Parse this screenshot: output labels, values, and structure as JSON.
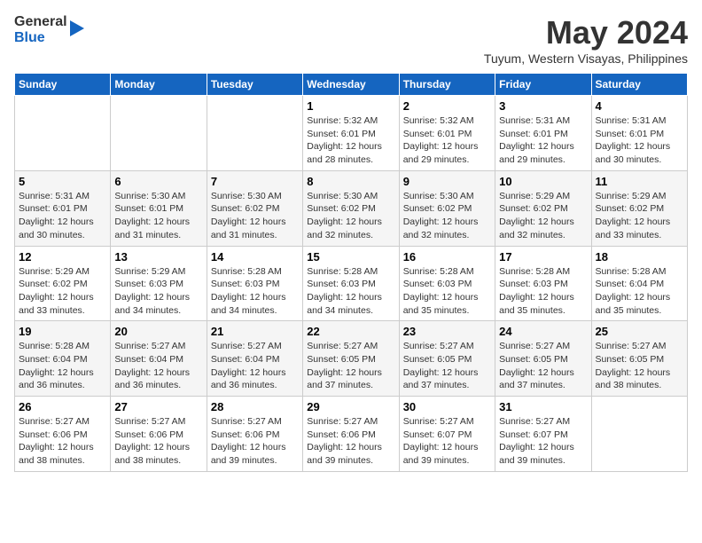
{
  "logo": {
    "general": "General",
    "blue": "Blue"
  },
  "title": "May 2024",
  "location": "Tuyum, Western Visayas, Philippines",
  "days_header": [
    "Sunday",
    "Monday",
    "Tuesday",
    "Wednesday",
    "Thursday",
    "Friday",
    "Saturday"
  ],
  "weeks": [
    [
      {
        "day": "",
        "info": ""
      },
      {
        "day": "",
        "info": ""
      },
      {
        "day": "",
        "info": ""
      },
      {
        "day": "1",
        "info": "Sunrise: 5:32 AM\nSunset: 6:01 PM\nDaylight: 12 hours\nand 28 minutes."
      },
      {
        "day": "2",
        "info": "Sunrise: 5:32 AM\nSunset: 6:01 PM\nDaylight: 12 hours\nand 29 minutes."
      },
      {
        "day": "3",
        "info": "Sunrise: 5:31 AM\nSunset: 6:01 PM\nDaylight: 12 hours\nand 29 minutes."
      },
      {
        "day": "4",
        "info": "Sunrise: 5:31 AM\nSunset: 6:01 PM\nDaylight: 12 hours\nand 30 minutes."
      }
    ],
    [
      {
        "day": "5",
        "info": "Sunrise: 5:31 AM\nSunset: 6:01 PM\nDaylight: 12 hours\nand 30 minutes."
      },
      {
        "day": "6",
        "info": "Sunrise: 5:30 AM\nSunset: 6:01 PM\nDaylight: 12 hours\nand 31 minutes."
      },
      {
        "day": "7",
        "info": "Sunrise: 5:30 AM\nSunset: 6:02 PM\nDaylight: 12 hours\nand 31 minutes."
      },
      {
        "day": "8",
        "info": "Sunrise: 5:30 AM\nSunset: 6:02 PM\nDaylight: 12 hours\nand 32 minutes."
      },
      {
        "day": "9",
        "info": "Sunrise: 5:30 AM\nSunset: 6:02 PM\nDaylight: 12 hours\nand 32 minutes."
      },
      {
        "day": "10",
        "info": "Sunrise: 5:29 AM\nSunset: 6:02 PM\nDaylight: 12 hours\nand 32 minutes."
      },
      {
        "day": "11",
        "info": "Sunrise: 5:29 AM\nSunset: 6:02 PM\nDaylight: 12 hours\nand 33 minutes."
      }
    ],
    [
      {
        "day": "12",
        "info": "Sunrise: 5:29 AM\nSunset: 6:02 PM\nDaylight: 12 hours\nand 33 minutes."
      },
      {
        "day": "13",
        "info": "Sunrise: 5:29 AM\nSunset: 6:03 PM\nDaylight: 12 hours\nand 34 minutes."
      },
      {
        "day": "14",
        "info": "Sunrise: 5:28 AM\nSunset: 6:03 PM\nDaylight: 12 hours\nand 34 minutes."
      },
      {
        "day": "15",
        "info": "Sunrise: 5:28 AM\nSunset: 6:03 PM\nDaylight: 12 hours\nand 34 minutes."
      },
      {
        "day": "16",
        "info": "Sunrise: 5:28 AM\nSunset: 6:03 PM\nDaylight: 12 hours\nand 35 minutes."
      },
      {
        "day": "17",
        "info": "Sunrise: 5:28 AM\nSunset: 6:03 PM\nDaylight: 12 hours\nand 35 minutes."
      },
      {
        "day": "18",
        "info": "Sunrise: 5:28 AM\nSunset: 6:04 PM\nDaylight: 12 hours\nand 35 minutes."
      }
    ],
    [
      {
        "day": "19",
        "info": "Sunrise: 5:28 AM\nSunset: 6:04 PM\nDaylight: 12 hours\nand 36 minutes."
      },
      {
        "day": "20",
        "info": "Sunrise: 5:27 AM\nSunset: 6:04 PM\nDaylight: 12 hours\nand 36 minutes."
      },
      {
        "day": "21",
        "info": "Sunrise: 5:27 AM\nSunset: 6:04 PM\nDaylight: 12 hours\nand 36 minutes."
      },
      {
        "day": "22",
        "info": "Sunrise: 5:27 AM\nSunset: 6:05 PM\nDaylight: 12 hours\nand 37 minutes."
      },
      {
        "day": "23",
        "info": "Sunrise: 5:27 AM\nSunset: 6:05 PM\nDaylight: 12 hours\nand 37 minutes."
      },
      {
        "day": "24",
        "info": "Sunrise: 5:27 AM\nSunset: 6:05 PM\nDaylight: 12 hours\nand 37 minutes."
      },
      {
        "day": "25",
        "info": "Sunrise: 5:27 AM\nSunset: 6:05 PM\nDaylight: 12 hours\nand 38 minutes."
      }
    ],
    [
      {
        "day": "26",
        "info": "Sunrise: 5:27 AM\nSunset: 6:06 PM\nDaylight: 12 hours\nand 38 minutes."
      },
      {
        "day": "27",
        "info": "Sunrise: 5:27 AM\nSunset: 6:06 PM\nDaylight: 12 hours\nand 38 minutes."
      },
      {
        "day": "28",
        "info": "Sunrise: 5:27 AM\nSunset: 6:06 PM\nDaylight: 12 hours\nand 39 minutes."
      },
      {
        "day": "29",
        "info": "Sunrise: 5:27 AM\nSunset: 6:06 PM\nDaylight: 12 hours\nand 39 minutes."
      },
      {
        "day": "30",
        "info": "Sunrise: 5:27 AM\nSunset: 6:07 PM\nDaylight: 12 hours\nand 39 minutes."
      },
      {
        "day": "31",
        "info": "Sunrise: 5:27 AM\nSunset: 6:07 PM\nDaylight: 12 hours\nand 39 minutes."
      },
      {
        "day": "",
        "info": ""
      }
    ]
  ]
}
